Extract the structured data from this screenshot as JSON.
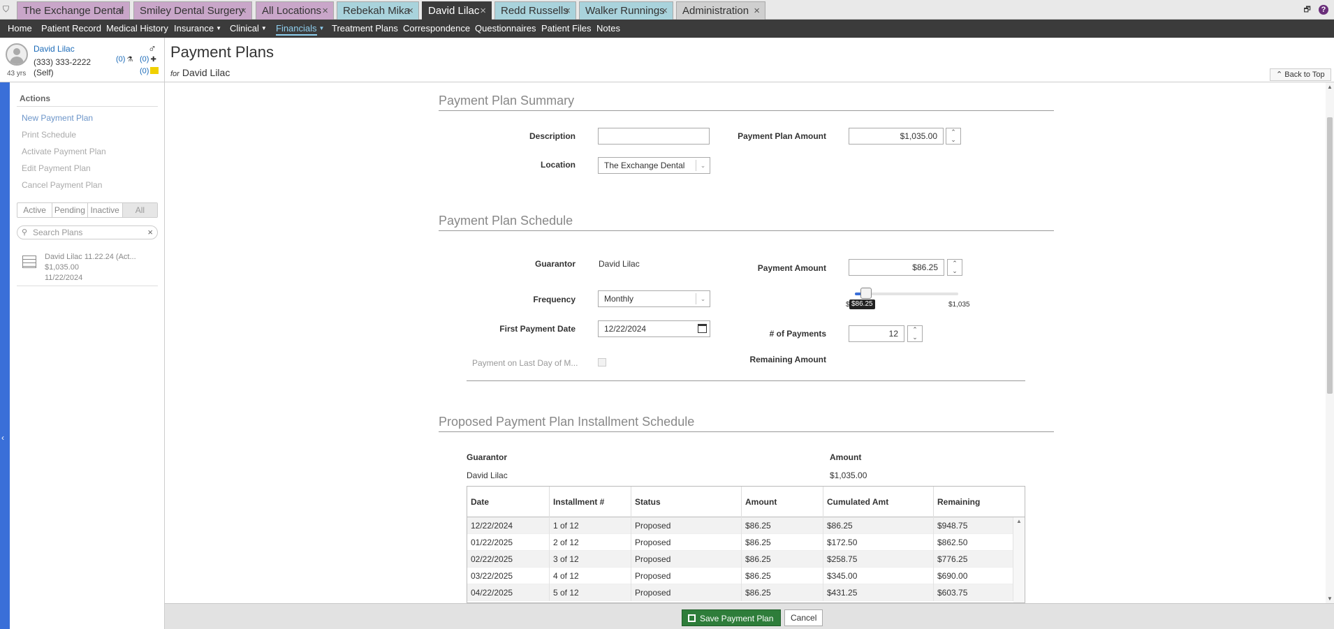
{
  "tabs": [
    {
      "label": "The Exchange Dental",
      "close": "+",
      "style": "purple"
    },
    {
      "label": "Smiley Dental Surgery",
      "close": "×",
      "style": "purple"
    },
    {
      "label": "All Locations",
      "close": "×",
      "style": "purple"
    },
    {
      "label": "Rebekah Mika",
      "close": "×",
      "style": "teal"
    },
    {
      "label": "David Lilac",
      "close": "×",
      "style": "active"
    },
    {
      "label": "Redd Russells",
      "close": "×",
      "style": "teal"
    },
    {
      "label": "Walker Runnings",
      "close": "×",
      "style": "teal"
    },
    {
      "label": "Administration",
      "close": "×",
      "style": "gray"
    }
  ],
  "nav": [
    "Home",
    "Patient Record",
    "Medical History",
    "Insurance",
    "Clinical",
    "Financials",
    "Treatment Plans",
    "Correspondence",
    "Questionnaires",
    "Patient Files",
    "Notes"
  ],
  "patient": {
    "name": "David Lilac",
    "phone": "(333) 333-2222",
    "relation": "(Self)",
    "age": "43 yrs",
    "gender_symbol": "♂",
    "badge_lab": "(0)",
    "badge_plus": "(0)",
    "badge_notes": "(0)"
  },
  "page": {
    "title": "Payment Plans",
    "for_label": "for",
    "for_name": "David Lilac",
    "back_to_top": "Back to Top"
  },
  "sidebar": {
    "actions_title": "Actions",
    "actions": [
      "New Payment Plan",
      "Print Schedule",
      "Activate Payment Plan",
      "Edit Payment Plan",
      "Cancel Payment Plan"
    ],
    "filters": [
      "Active",
      "Pending",
      "Inactive",
      "All"
    ],
    "search_placeholder": "Search Plans",
    "plan": {
      "title": "David Lilac 11.22.24 (Act...",
      "amount": "$1,035.00",
      "date": "11/22/2024"
    }
  },
  "summary": {
    "title": "Payment Plan Summary",
    "description_label": "Description",
    "description_value": "",
    "amount_label": "Payment Plan Amount",
    "amount_value": "$1,035.00",
    "location_label": "Location",
    "location_value": "The Exchange Dental"
  },
  "schedule": {
    "title": "Payment Plan Schedule",
    "guarantor_label": "Guarantor",
    "guarantor_value": "David Lilac",
    "payment_amount_label": "Payment Amount",
    "payment_amount_value": "$86.25",
    "frequency_label": "Frequency",
    "frequency_value": "Monthly",
    "first_date_label": "First Payment Date",
    "first_date_value": "12/22/2024",
    "num_payments_label": "# of Payments",
    "num_payments_value": "12",
    "last_day_label": "Payment on Last Day of M...",
    "remaining_label": "Remaining Amount",
    "slider": {
      "min_label": "$",
      "max_label": "$1,035",
      "tooltip": "$86.25",
      "level": 0.083
    }
  },
  "proposed": {
    "title": "Proposed Payment Plan Installment Schedule",
    "guarantor_head": "Guarantor",
    "amount_head": "Amount",
    "guarantor_value": "David Lilac",
    "amount_value": "$1,035.00",
    "columns": [
      "Date",
      "Installment #",
      "Status",
      "Amount",
      "Cumulated Amt",
      "Remaining"
    ],
    "rows": [
      [
        "12/22/2024",
        "1 of 12",
        "Proposed",
        "$86.25",
        "$86.25",
        "$948.75"
      ],
      [
        "01/22/2025",
        "2 of 12",
        "Proposed",
        "$86.25",
        "$172.50",
        "$862.50"
      ],
      [
        "02/22/2025",
        "3 of 12",
        "Proposed",
        "$86.25",
        "$258.75",
        "$776.25"
      ],
      [
        "03/22/2025",
        "4 of 12",
        "Proposed",
        "$86.25",
        "$345.00",
        "$690.00"
      ],
      [
        "04/22/2025",
        "5 of 12",
        "Proposed",
        "$86.25",
        "$431.25",
        "$603.75"
      ]
    ]
  },
  "footer": {
    "save_label": "Save Payment Plan",
    "cancel_label": "Cancel"
  }
}
